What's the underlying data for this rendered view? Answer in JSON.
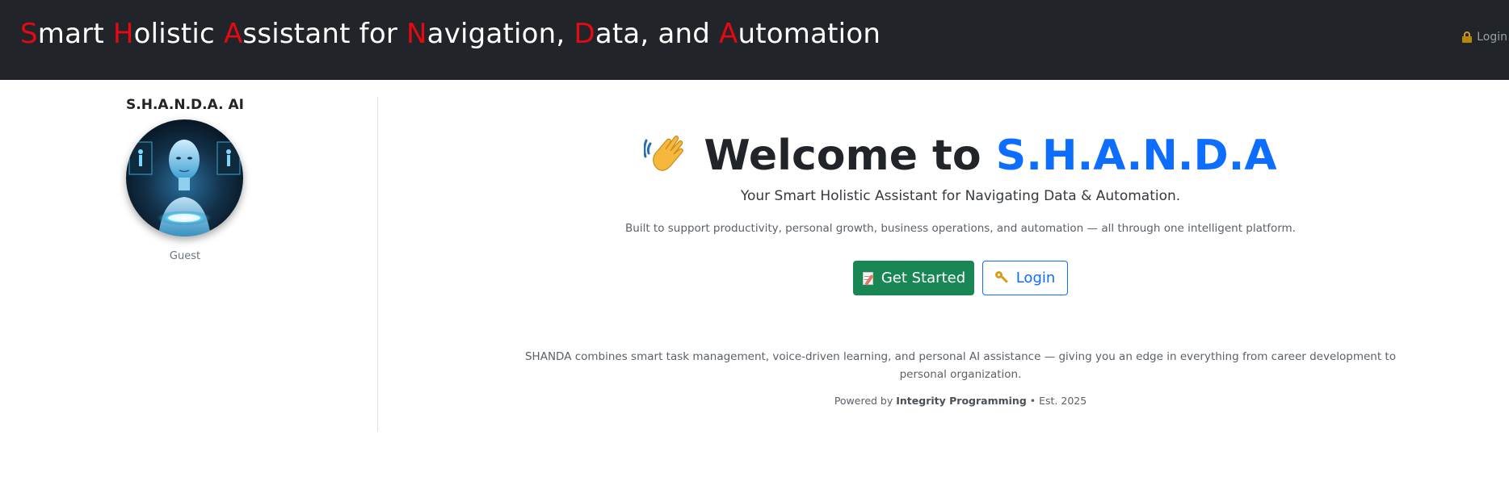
{
  "header": {
    "brand_parts": [
      {
        "initial": "S",
        "rest": "mart "
      },
      {
        "initial": "H",
        "rest": "olistic "
      },
      {
        "initial": "A",
        "rest": "ssistant for "
      },
      {
        "initial": "N",
        "rest": "avigation, "
      },
      {
        "initial": "D",
        "rest": "ata, and "
      },
      {
        "initial": "A",
        "rest": "utomation"
      }
    ],
    "login_label": "Login",
    "login_icon": "lock-icon"
  },
  "sidebar": {
    "title": "S.H.A.N.D.A. AI",
    "role": "Guest",
    "avatar": "ai-avatar-image"
  },
  "main": {
    "welcome_prefix": "Welcome to",
    "welcome_accent": "S.H.A.N.D.A",
    "welcome_icon": "waving-hand-icon",
    "subtitle": "Your Smart Holistic Assistant for Navigating Data & Automation.",
    "description": "Built to support productivity, personal growth, business operations, and automation — all through one intelligent platform.",
    "get_started_label": "Get Started",
    "get_started_icon": "memo-icon",
    "login_label": "Login",
    "login_icon": "key-icon",
    "about": "SHANDA combines smart task management, voice-driven learning, and personal AI assistance — giving you an edge in everything from career development to personal organization.",
    "powered_prefix": "Powered by",
    "powered_company": "Integrity Programming",
    "powered_suffix": "• Est. 2025"
  },
  "colors": {
    "header_bg": "#212529",
    "brand_initial": "#e50914",
    "accent_blue": "#0d6efd",
    "success_green": "#198754"
  }
}
